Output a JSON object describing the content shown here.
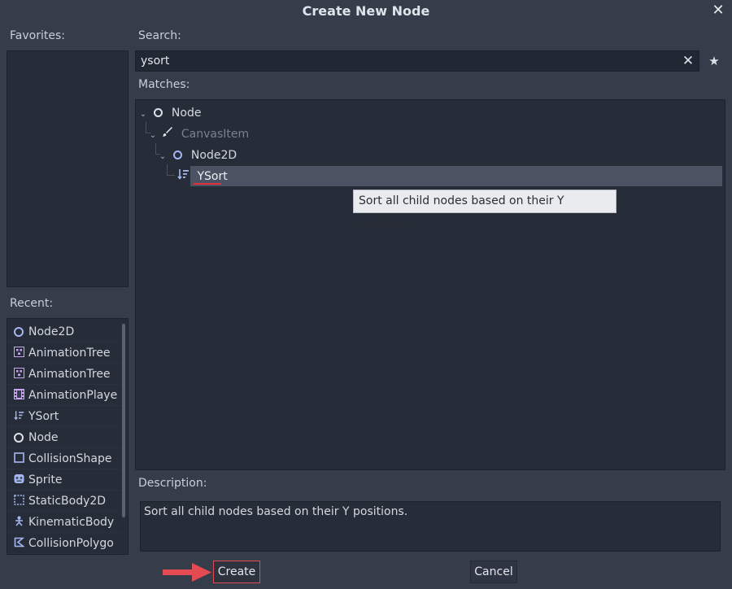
{
  "dialog": {
    "title": "Create New Node",
    "close": "✕"
  },
  "favorites": {
    "label": "Favorites:"
  },
  "search": {
    "label": "Search:",
    "value": "ysort",
    "clear": "✕",
    "favorite": "★"
  },
  "matches": {
    "label": "Matches:",
    "tree": [
      {
        "label": "Node",
        "icon": "circle-icon",
        "dim": false
      },
      {
        "label": "CanvasItem",
        "icon": "brush-icon",
        "dim": true
      },
      {
        "label": "Node2D",
        "icon": "circle-icon",
        "dim": false
      },
      {
        "label": "YSort",
        "icon": "ysort-icon",
        "dim": false,
        "selected": true
      }
    ],
    "tooltip": "Sort all child nodes based on their Y positions."
  },
  "recent": {
    "label": "Recent:",
    "items": [
      {
        "label": "Node2D",
        "icon": "circle-icon"
      },
      {
        "label": "AnimationTree",
        "icon": "animation-tree-icon"
      },
      {
        "label": "AnimationTree",
        "icon": "animation-tree-icon"
      },
      {
        "label": "AnimationPlaye",
        "icon": "film-icon"
      },
      {
        "label": "YSort",
        "icon": "ysort-icon"
      },
      {
        "label": "Node",
        "icon": "circle-icon"
      },
      {
        "label": "CollisionShape",
        "icon": "square-icon"
      },
      {
        "label": "Sprite",
        "icon": "sprite-icon"
      },
      {
        "label": "StaticBody2D",
        "icon": "dashed-square-icon"
      },
      {
        "label": "KinematicBody",
        "icon": "kinematic-icon"
      },
      {
        "label": "CollisionPolygo",
        "icon": "polygon-icon"
      }
    ]
  },
  "description": {
    "label": "Description:",
    "text": "Sort all child nodes based on their Y positions."
  },
  "buttons": {
    "create": "Create",
    "cancel": "Cancel"
  },
  "colors": {
    "background": "#363d4a",
    "panel": "#262c38",
    "selection": "#4b5262",
    "accent_red": "#e44a52",
    "node2d_blue": "#a5b7f2",
    "anim_purple": "#c9a6f2"
  }
}
